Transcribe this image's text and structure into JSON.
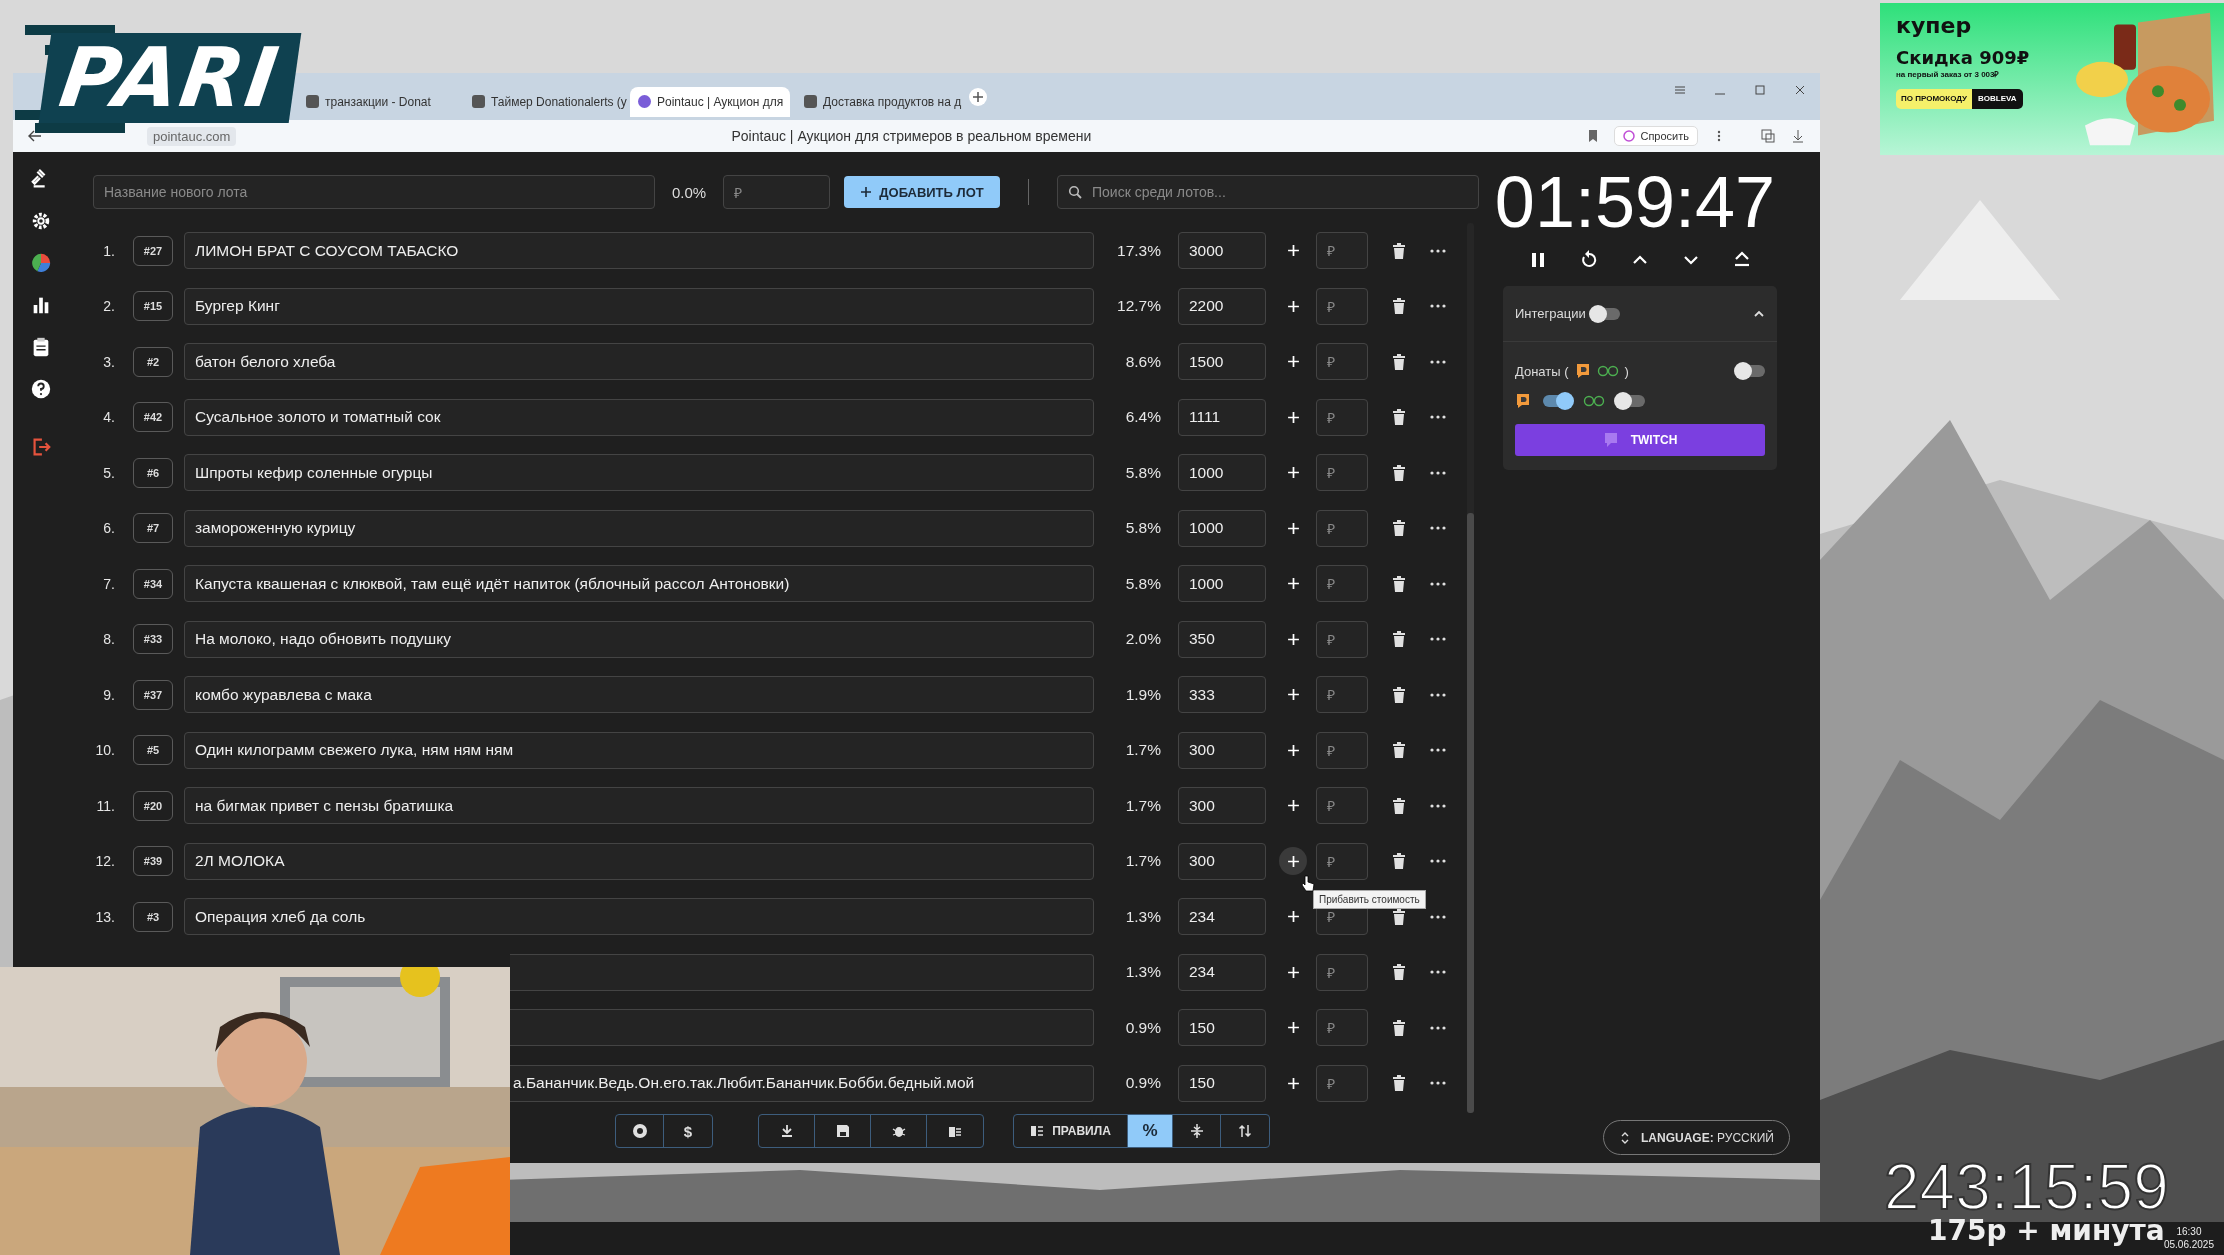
{
  "stream_overlay": {
    "logo": "PARI",
    "timer": "243:15:59",
    "rate": "175р + минута"
  },
  "ad": {
    "brand": "купер",
    "headline": "Скидка 909₽",
    "subline": "на первый заказ от 3 003₽",
    "promo_label": "ПО ПРОМОКОДУ",
    "promo_code": "BOBLEVA"
  },
  "browser": {
    "tabs": [
      {
        "title": "транзакции - Donat",
        "selected": false
      },
      {
        "title": "Таймер Donationalerts (у",
        "selected": false
      },
      {
        "title": "Pointauc | Аукцион для",
        "selected": true
      },
      {
        "title": "Доставка продуктов на д",
        "selected": false
      }
    ],
    "url": "pointauc.com",
    "page_title": "Pointauc | Аукцион для стримеров в реальном времени",
    "ask_button": "Спросить"
  },
  "app": {
    "new_lot": {
      "placeholder": "Название нового лота",
      "percent": "0.0%",
      "amount_placeholder": "₽",
      "add_button": "ДОБАВИТЬ ЛОТ"
    },
    "search": {
      "placeholder": "Поиск среди лотов..."
    },
    "lots": [
      {
        "number": "1.",
        "id": "#27",
        "name": "ЛИМОН БРАТ С СОУСОМ ТАБАСКО",
        "percent": "17.3%",
        "amount": "3000",
        "bid_placeholder": "₽",
        "hovered": false
      },
      {
        "number": "2.",
        "id": "#15",
        "name": "Бургер Кинг",
        "percent": "12.7%",
        "amount": "2200",
        "bid_placeholder": "₽",
        "hovered": false
      },
      {
        "number": "3.",
        "id": "#2",
        "name": "батон белого хлеба",
        "percent": "8.6%",
        "amount": "1500",
        "bid_placeholder": "₽",
        "hovered": false
      },
      {
        "number": "4.",
        "id": "#42",
        "name": "Сусальное золото и томатный сок",
        "percent": "6.4%",
        "amount": "1111",
        "bid_placeholder": "₽",
        "hovered": false
      },
      {
        "number": "5.",
        "id": "#6",
        "name": "Шпроты кефир соленные огурцы",
        "percent": "5.8%",
        "amount": "1000",
        "bid_placeholder": "₽",
        "hovered": false
      },
      {
        "number": "6.",
        "id": "#7",
        "name": "замороженную курицу",
        "percent": "5.8%",
        "amount": "1000",
        "bid_placeholder": "₽",
        "hovered": false
      },
      {
        "number": "7.",
        "id": "#34",
        "name": "Капуста квашеная с клюквой, там ещё идёт напиток (яблочный рассол Антоновки)",
        "percent": "5.8%",
        "amount": "1000",
        "bid_placeholder": "₽",
        "hovered": false
      },
      {
        "number": "8.",
        "id": "#33",
        "name": "На молоко, надо обновить подушку",
        "percent": "2.0%",
        "amount": "350",
        "bid_placeholder": "₽",
        "hovered": false
      },
      {
        "number": "9.",
        "id": "#37",
        "name": "комбо журавлева с мака",
        "percent": "1.9%",
        "amount": "333",
        "bid_placeholder": "₽",
        "hovered": false
      },
      {
        "number": "10.",
        "id": "#5",
        "name": "Один килограмм свежего лука, ням ням ням",
        "percent": "1.7%",
        "amount": "300",
        "bid_placeholder": "₽",
        "hovered": false
      },
      {
        "number": "11.",
        "id": "#20",
        "name": "на бигмак привет с пензы братишка",
        "percent": "1.7%",
        "amount": "300",
        "bid_placeholder": "₽",
        "hovered": false
      },
      {
        "number": "12.",
        "id": "#39",
        "name": "2Л МОЛОКА",
        "percent": "1.7%",
        "amount": "300",
        "bid_placeholder": "₽",
        "hovered": true
      },
      {
        "number": "13.",
        "id": "#3",
        "name": "Операция хлеб да соль",
        "percent": "1.3%",
        "amount": "234",
        "bid_placeholder": "₽",
        "hovered": false
      },
      {
        "percent": "1.3%",
        "amount": "234",
        "bid_placeholder": "₽",
        "hovered": false
      },
      {
        "percent": "0.9%",
        "amount": "150",
        "bid_placeholder": "₽",
        "hovered": false
      },
      {
        "name": "а.Бананчик.Ведь.Он.его.так.Любит.Бананчик.Бобби.бедный.мой",
        "percent": "0.9%",
        "amount": "150",
        "bid_placeholder": "₽",
        "hovered": false
      }
    ],
    "tooltip": "Прибавить стоимость",
    "timer": "01:59:47",
    "integrations": {
      "title": "Интеграции",
      "on": false,
      "expanded": true,
      "donations_label": "Донаты (",
      "donations_close": ")",
      "donations_on": false,
      "donationalerts_on": true,
      "donatepay_on": false,
      "twitch_button": "TWITCH"
    },
    "toolbar": {
      "donate_button": "$",
      "rules_button": "ПРАВИЛА",
      "percent_button": "%",
      "percent_selected": true,
      "language_button": "**LANGUAGE:** РУССКИЙ"
    }
  },
  "taskbar": {
    "time": "16:30",
    "date": "05.06.2025"
  }
}
